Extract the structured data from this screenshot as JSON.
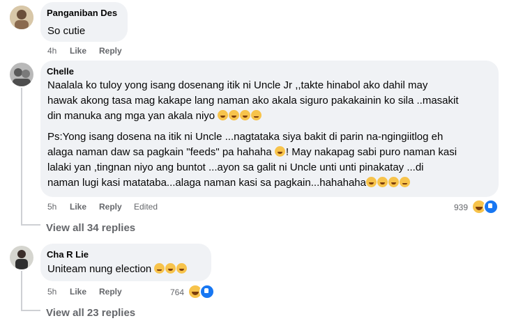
{
  "comments": [
    {
      "author": "Panganiban Des",
      "text_lines": [
        "So cutie"
      ],
      "time": "4h",
      "like_label": "Like",
      "reply_label": "Reply"
    },
    {
      "author": "Chelle",
      "text_lines": [
        "Naalala ko tuloy yong isang dosenang itik ni Uncle Jr ,,takte hinabol ako dahil may",
        "hawak akong tasa mag kakape lang naman ako akala siguro pakakainin ko sila ..masakit",
        "din manuka ang mga yan akala niyo"
      ],
      "text2_lines": [
        "Ps:Yong isang dosena na itik ni Uncle ...nagtataka siya bakit di parin na-ngingiitlog eh",
        "alaga naman daw sa pagkain \"feeds\" pa hahaha",
        "lalaki yan ,tingnan niyo ang buntot ...ayon sa galit ni Uncle unti unti pinakatay ...di",
        "naman lugi kasi matataba...alaga naman kasi sa pagkain...hahahaha"
      ],
      "text2_inline": "! May nakapag sabi puro naman kasi",
      "time": "5h",
      "like_label": "Like",
      "reply_label": "Reply",
      "edited_label": "Edited",
      "reaction_count": "939",
      "view_replies": "View all 34 replies"
    },
    {
      "author": "Cha R Lie",
      "text_lines": [
        "Uniteam nung election"
      ],
      "time": "5h",
      "like_label": "Like",
      "reply_label": "Reply",
      "reaction_count": "764",
      "view_replies": "View all 23 replies"
    }
  ],
  "colors": {
    "bubble": "#f0f2f5",
    "meta": "#65676b",
    "like_blue": "#1877f2",
    "haha": "#f7c34b"
  },
  "icons": [
    "laugh-emoji",
    "like-reaction-icon",
    "haha-reaction-icon"
  ]
}
